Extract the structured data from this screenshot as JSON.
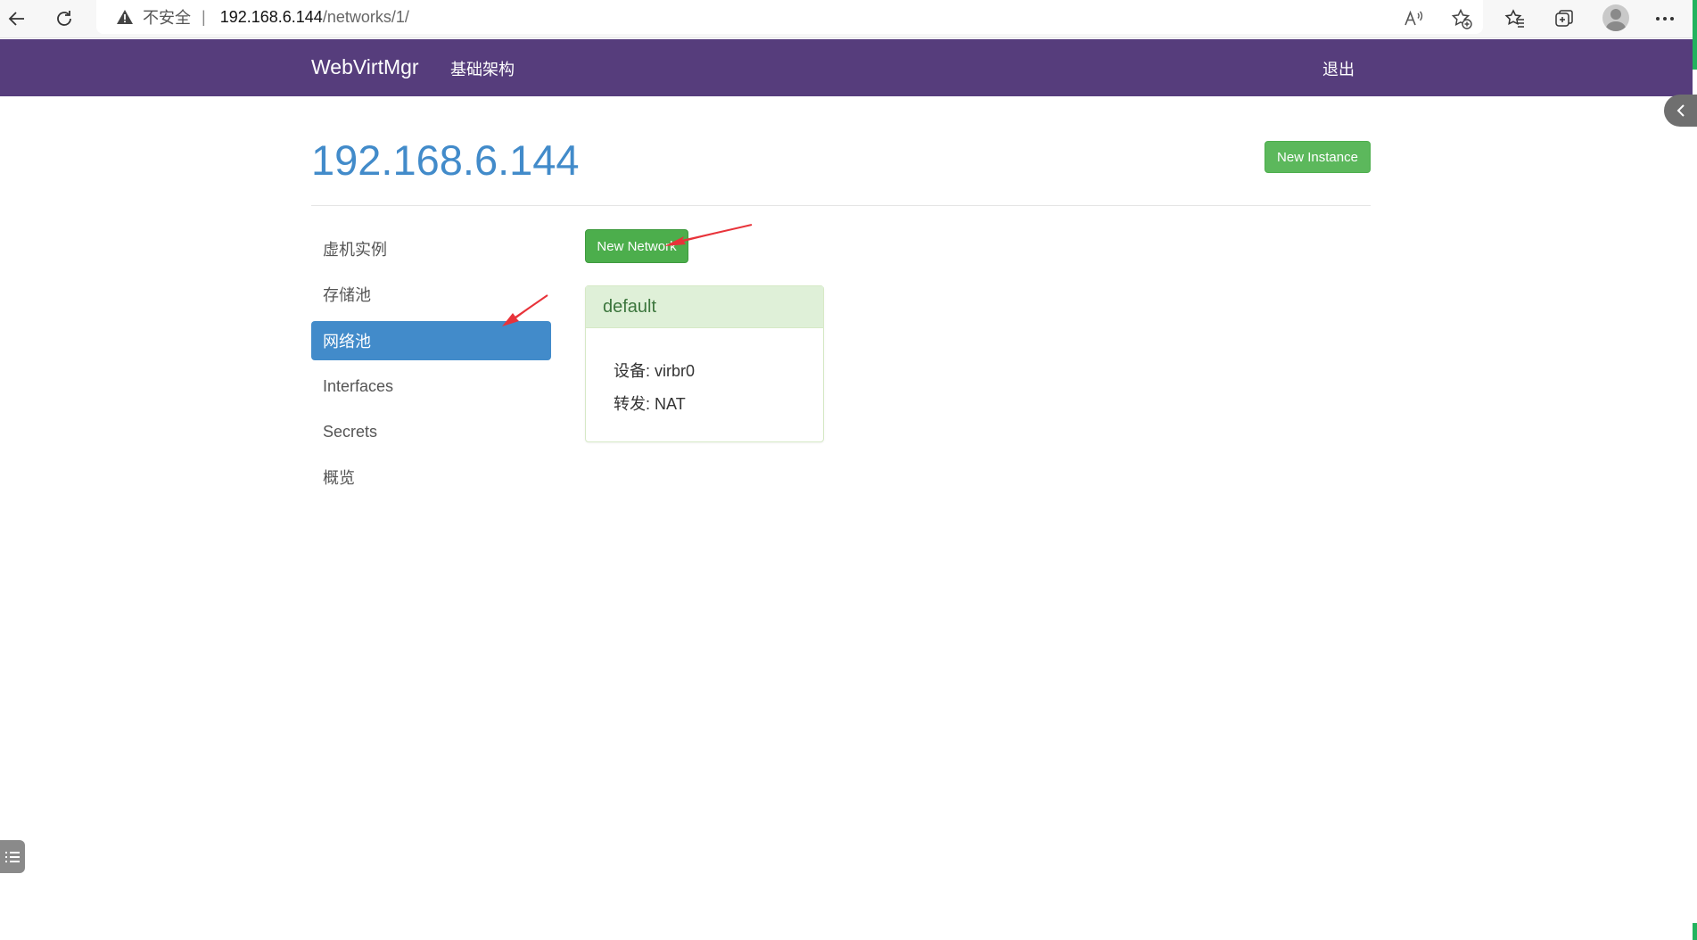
{
  "browser": {
    "insecure_label": "不安全",
    "separator": "|",
    "url_host": "192.168.6.144",
    "url_path": "/networks/1/"
  },
  "navbar": {
    "brand": "WebVirtMgr",
    "infrastructure_label": "基础架构",
    "logout_label": "退出",
    "background_color": "#563d7c"
  },
  "header": {
    "title": "192.168.6.144",
    "new_instance_label": "New Instance"
  },
  "sidebar": {
    "items": [
      {
        "label": "虚机实例",
        "active": false
      },
      {
        "label": "存储池",
        "active": false
      },
      {
        "label": "网络池",
        "active": true
      },
      {
        "label": "Interfaces",
        "active": false
      },
      {
        "label": "Secrets",
        "active": false
      },
      {
        "label": "概览",
        "active": false
      }
    ]
  },
  "main": {
    "new_network_label": "New Network",
    "networks": [
      {
        "name": "default",
        "device_label": "设备:",
        "device_value": "virbr0",
        "forward_label": "转发:",
        "forward_value": "NAT"
      }
    ]
  },
  "colors": {
    "accent": "#428bca",
    "success": "#5cb85c",
    "arrow": "#e8333a"
  }
}
